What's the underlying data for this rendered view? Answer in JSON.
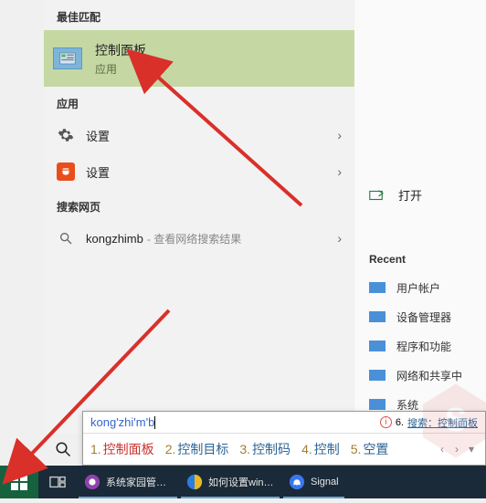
{
  "sections": {
    "best_match": "最佳匹配",
    "apps": "应用",
    "search_web": "搜索网页"
  },
  "best_match_item": {
    "title": "控制面板",
    "subtitle": "应用"
  },
  "app_items": [
    {
      "label": "设置"
    },
    {
      "label": "设置"
    }
  ],
  "web_item": {
    "query": "kongzhimb",
    "hint": "查看网络搜索结果"
  },
  "right": {
    "open": "打开",
    "recent_header": "Recent",
    "recent": [
      "用户帐户",
      "设备管理器",
      "程序和功能",
      "网络和共享中",
      "系统"
    ]
  },
  "ime": {
    "input": "kong'zhi'm'b",
    "hint_num": "6.",
    "hint_text": "搜索：控制面板",
    "candidates": [
      {
        "n": "1.",
        "t": "控制面板"
      },
      {
        "n": "2.",
        "t": "控制目标"
      },
      {
        "n": "3.",
        "t": "控制码"
      },
      {
        "n": "4.",
        "t": "控制"
      },
      {
        "n": "5.",
        "t": "空置"
      }
    ]
  },
  "taskbar": {
    "apps": [
      {
        "label": "系统家园管理...",
        "color": "#8e44ad"
      },
      {
        "label": "如何设置win1...",
        "color": "#2b7de1"
      },
      {
        "label": "Signal",
        "color": "#3a76f0"
      }
    ]
  }
}
